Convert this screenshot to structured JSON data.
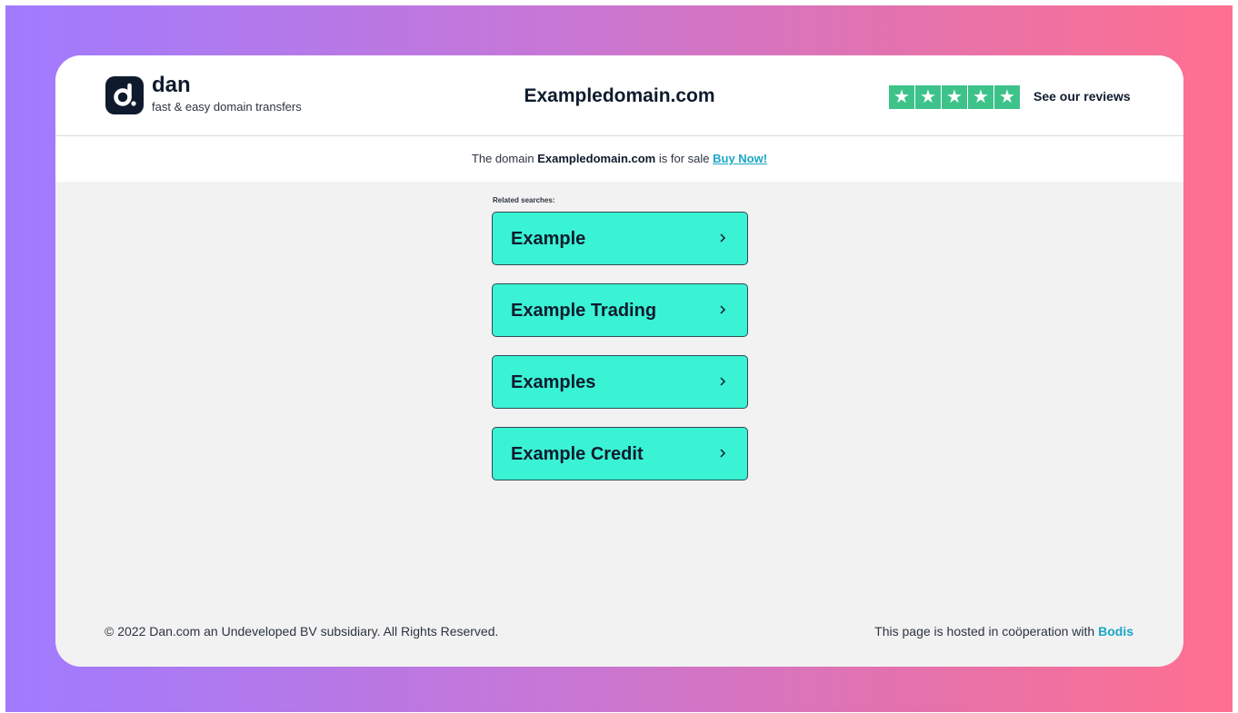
{
  "brand": {
    "name": "dan",
    "tagline": "fast & easy domain transfers",
    "logo_icon": "dan-logo-icon"
  },
  "header": {
    "domain": "Exampledomain.com",
    "rating_stars": 5,
    "reviews_link": "See our reviews"
  },
  "sale_bar": {
    "prefix": "The domain",
    "domain": "Exampledomain.com",
    "suffix": "is for sale",
    "cta": "Buy Now!"
  },
  "related": {
    "label": "Related searches:",
    "items": [
      {
        "label": "Example"
      },
      {
        "label": "Example Trading"
      },
      {
        "label": "Examples"
      },
      {
        "label": "Example Credit"
      }
    ]
  },
  "footer": {
    "copyright": "© 2022 Dan.com an Undeveloped BV subsidiary. All Rights Reserved.",
    "hosted_text": "This page is hosted in coöperation with",
    "hosted_link": "Bodis"
  },
  "colors": {
    "star_green": "#3dc38a",
    "button_teal": "#3af2d4",
    "link_blue": "#1aa6c8",
    "brand_navy": "#0f1b2d"
  }
}
